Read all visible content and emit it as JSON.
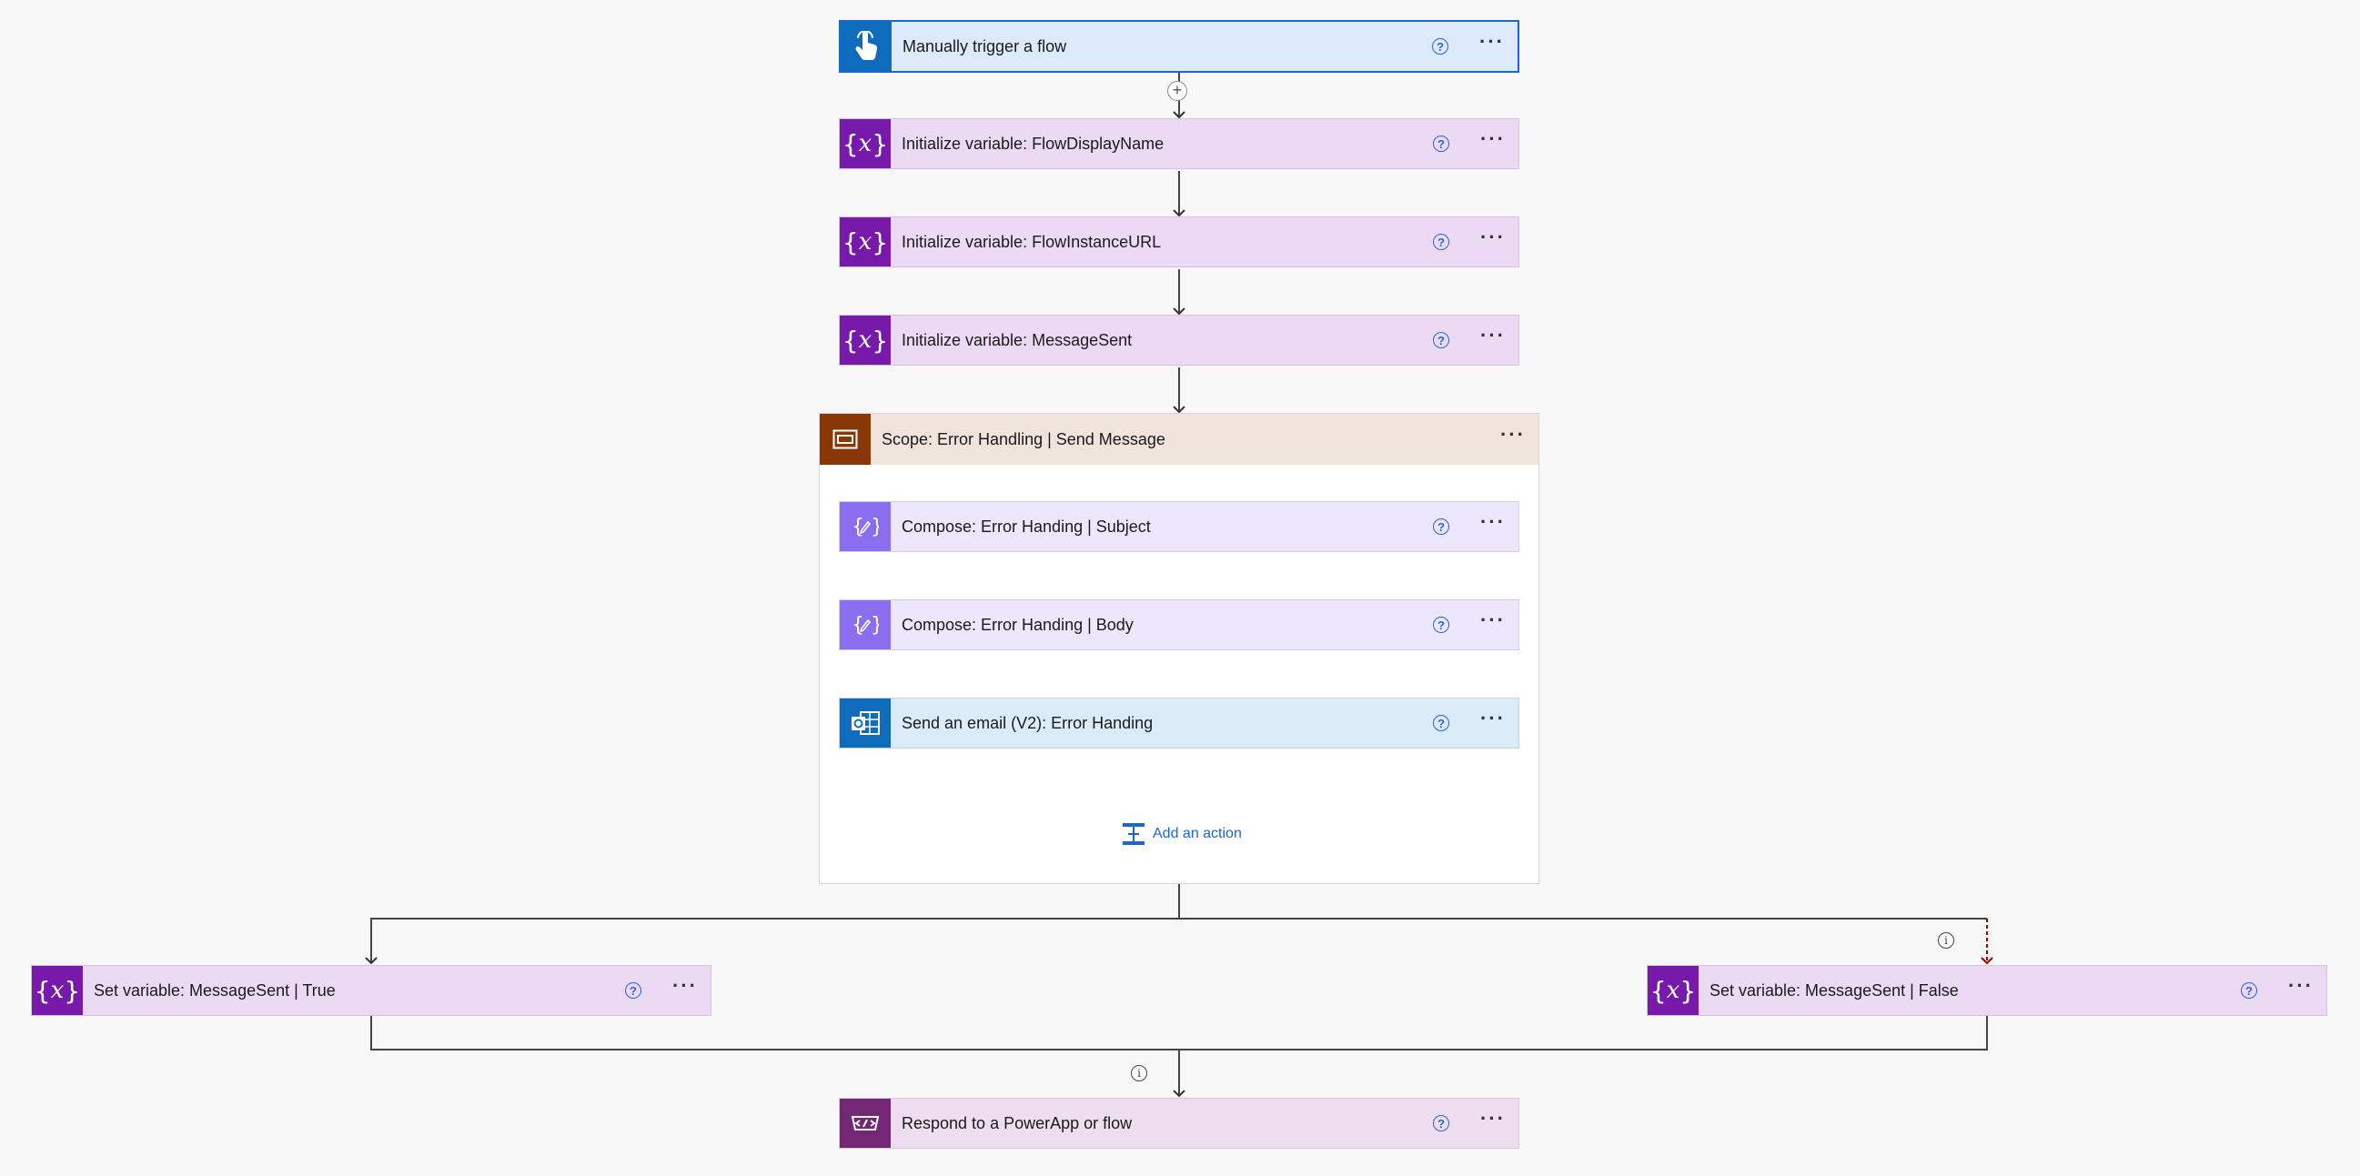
{
  "trigger": {
    "label": "Manually trigger a flow",
    "icon": "touch-hand-icon"
  },
  "init_vars": [
    {
      "label": "Initialize variable: FlowDisplayName"
    },
    {
      "label": "Initialize variable: FlowInstanceURL"
    },
    {
      "label": "Initialize variable: MessageSent"
    }
  ],
  "variable_icon": {
    "left": "{",
    "var": "x",
    "right": "}"
  },
  "scope": {
    "label": "Scope: Error Handling | Send Message",
    "actions": [
      {
        "label": "Compose: Error Handing | Subject"
      },
      {
        "label": "Compose: Error Handing | Body"
      },
      {
        "label": "Send an email (V2): Error Handing"
      }
    ],
    "add_action_label": "Add an action"
  },
  "branches": {
    "true_label": "Set variable: MessageSent | True",
    "false_label": "Set variable: MessageSent | False"
  },
  "respond": {
    "label": "Respond to a PowerApp or flow"
  },
  "symbols": {
    "help": "?",
    "more": "···",
    "info": "i",
    "plus": "+"
  },
  "colors": {
    "trigger": "#0f6cbd",
    "variable": "#7719aa",
    "scope": "#8a3707",
    "compose": "#8b6ef0",
    "email": "#0f6cbd",
    "respond": "#742774",
    "failure_arrow": "#a80000"
  }
}
